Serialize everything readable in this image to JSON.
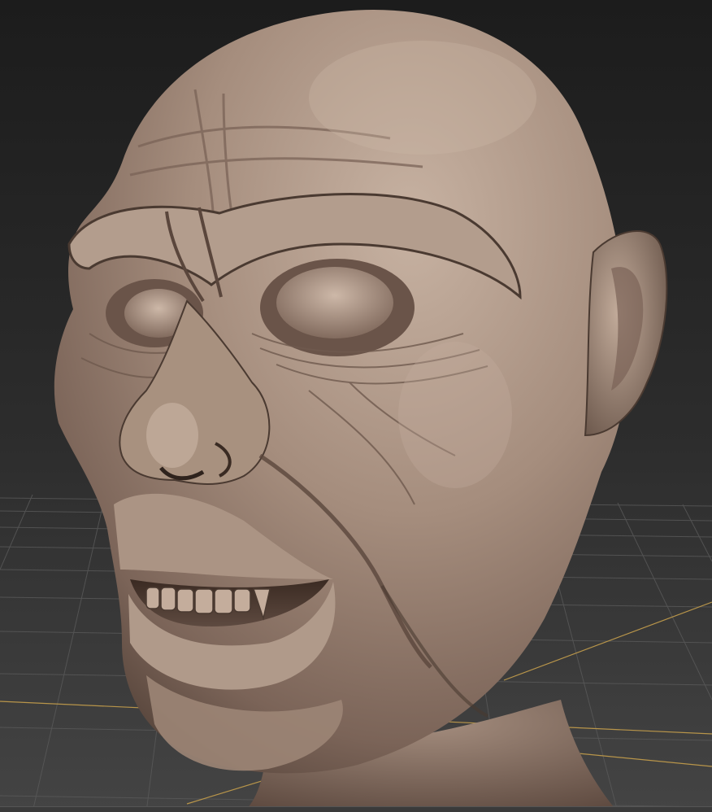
{
  "viewport": {
    "mode": "perspective",
    "shading": "matcap-clay",
    "grid_visible": true,
    "axis_lines_visible": true,
    "sculpt_object": "primate-head-bust",
    "colors": {
      "background_top": "#1c1c1c",
      "background_bottom": "#3e3e3e",
      "grid_line": "#5a5a5a",
      "axis_line": "#b8954a",
      "clay_base": "#a08878",
      "clay_highlight": "#c9b3a3",
      "clay_shadow": "#3e2f28"
    }
  }
}
